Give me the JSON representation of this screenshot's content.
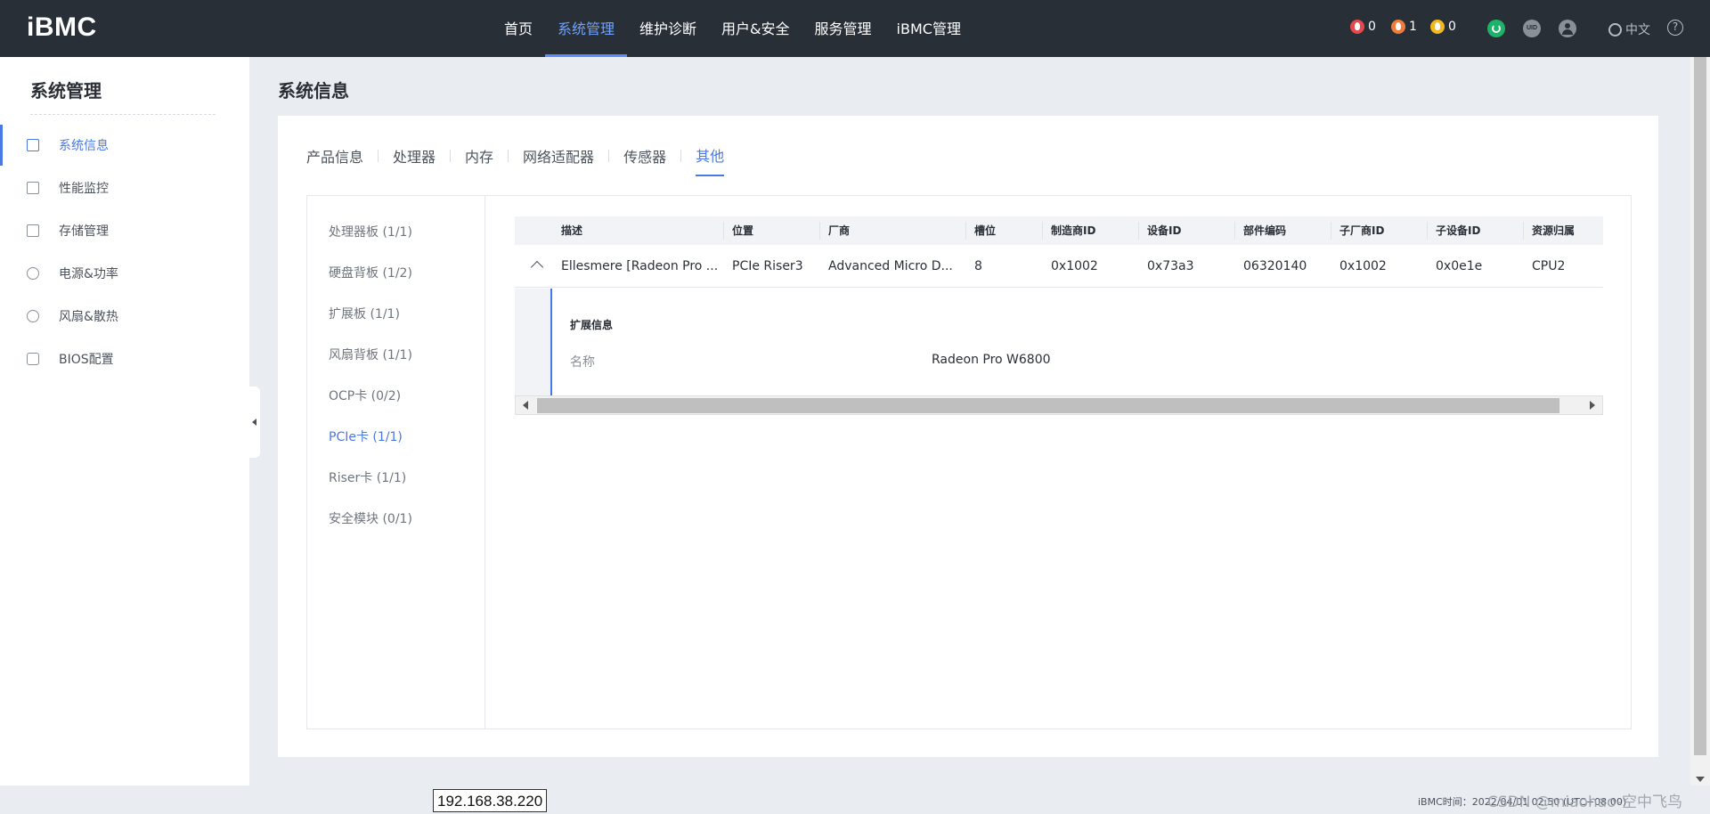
{
  "header": {
    "logo": "iBMC",
    "nav": [
      "首页",
      "系统管理",
      "维护诊断",
      "用户&安全",
      "服务管理",
      "iBMC管理"
    ],
    "active_nav_index": 1,
    "alerts": [
      {
        "icon": "critical-alarm-icon",
        "color": "#e5484d",
        "count": "0"
      },
      {
        "icon": "major-alarm-icon",
        "color": "#f07c3a",
        "count": "1"
      },
      {
        "icon": "minor-alarm-icon",
        "color": "#f2b81f",
        "count": "0"
      }
    ],
    "uid_label": "UID",
    "language": "中文",
    "help_glyph": "?"
  },
  "sidebar": {
    "title": "系统管理",
    "items": [
      {
        "label": "系统信息",
        "icon": "system-info-icon"
      },
      {
        "label": "性能监控",
        "icon": "performance-chart-icon"
      },
      {
        "label": "存储管理",
        "icon": "storage-icon"
      },
      {
        "label": "电源&功率",
        "icon": "power-icon"
      },
      {
        "label": "风扇&散热",
        "icon": "fan-icon"
      },
      {
        "label": "BIOS配置",
        "icon": "bios-icon"
      }
    ],
    "active_index": 0
  },
  "main": {
    "title": "系统信息",
    "tabs": [
      "产品信息",
      "处理器",
      "内存",
      "网络适配器",
      "传感器",
      "其他"
    ],
    "active_tab_index": 5,
    "categories": [
      "处理器板 (1/1)",
      "硬盘背板 (1/2)",
      "扩展板 (1/1)",
      "风扇背板 (1/1)",
      "OCP卡 (0/2)",
      "PCIe卡 (1/1)",
      "Riser卡 (1/1)",
      "安全模块 (0/1)"
    ],
    "active_category_index": 5,
    "table": {
      "columns": [
        "描述",
        "位置",
        "厂商",
        "槽位",
        "制造商ID",
        "设备ID",
        "部件编码",
        "子厂商ID",
        "子设备ID",
        "资源归属"
      ],
      "rows": [
        [
          "Ellesmere [Radeon Pro ...",
          "PCIe Riser3",
          "Advanced Micro D...",
          "8",
          "0x1002",
          "0x73a3",
          "06320140",
          "0x1002",
          "0x0e1e",
          "CPU2"
        ]
      ],
      "detail": {
        "title": "扩展信息",
        "label": "名称",
        "value": "Radeon Pro W6800"
      }
    }
  },
  "footer": {
    "ip": "192.168.38.220",
    "time_text": "iBMC时间：2022/04/01 02:50 (UTC+08:00)",
    "watermark": "CSDN @miaohao-空中飞鸟"
  }
}
